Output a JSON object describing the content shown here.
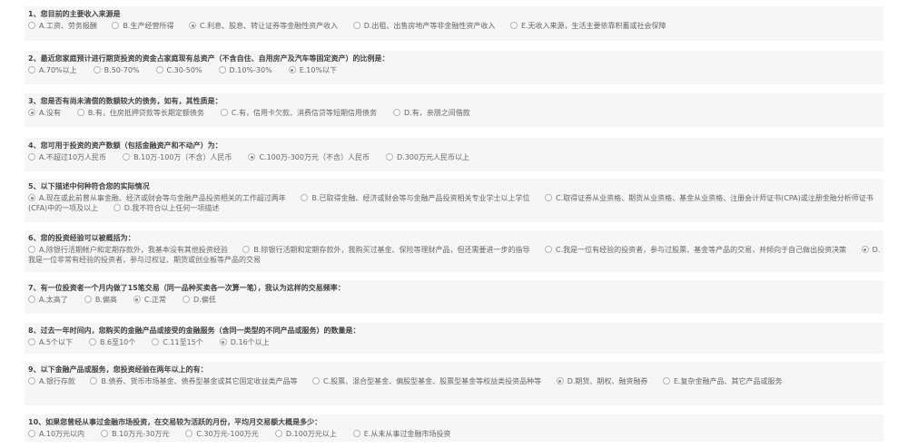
{
  "questions": [
    {
      "title": "1、您目前的主要收入来源是",
      "selected": 2,
      "wrap": true,
      "options": [
        "A.工资、劳务报酬",
        "B.生产经营所得",
        "C.利息、股息、转让证券等金融性资产收入",
        "D.出租、出售房地产等非金融性资产收入",
        "E.无收入来源，生活主要依靠积蓄或社会保障"
      ]
    },
    {
      "title": "2、最近您家庭预计进行期货投资的资金占家庭现有总资产（不含自住、自用房产及汽车等固定资产）的比例是：",
      "selected": 4,
      "wrap": false,
      "options": [
        "A.70%以上",
        "B.50-70%",
        "C.30-50%",
        "D.10%-30%",
        "E.10%以下"
      ]
    },
    {
      "title": "3、您是否有尚未清偿的数额较大的债务，如有，其性质是：",
      "selected": 0,
      "wrap": false,
      "options": [
        "A.没有",
        "B.有，住房抵押贷款等长期定额债务",
        "C.有，信用卡欠款、消费信贷等短期信用债务",
        "D.有，亲朋之间借款"
      ]
    },
    {
      "title": "4、您可用于投资的资产数额（包括金融资产和不动产）为：",
      "selected": 2,
      "wrap": false,
      "options": [
        "A.不超过10万人民币",
        "B.10万-100万（不含）人民币",
        "C.100万-300万元（不含）人民币",
        "D.300万元人民币以上"
      ]
    },
    {
      "title": "5、以下描述中何种符合您的实际情况",
      "selected": 0,
      "wrap": true,
      "options": [
        "A.现在或此前曾从事金融、经济或财会等与金融产品投资相关的工作超过两年",
        "B.已取得金融、经济或财会等与金融产品投资相关专业学士以上学位",
        "C.取得证券从业资格、期货从业资格、基金从业资格、注册会计师证书(CPA)或注册金融分析师证书(CFA)中的一项及以上",
        "D.我不符合以上任何一项描述"
      ]
    },
    {
      "title": "6、您的投资经验可以被概括为：",
      "selected": 3,
      "wrap": true,
      "options": [
        "A.除银行活期帐户和定期存款外，我基本没有其他投资经验",
        "B.除银行活期和定期存款外，我购买过基金、保险等理财产品，但还需要进一步的指导",
        "C.我是一位有经验的投资者，参与过股票、基金等产品的交易，并倾向于自己做出投资决策",
        "D.我是一位非常有经验的投资者，参与过权证、期货或创业板等产品的交易"
      ]
    },
    {
      "title": "7、有一位投资者一个月内做了15笔交易（同一品种买卖各一次算一笔），我认为这样的交易频率：",
      "selected": 2,
      "wrap": false,
      "options": [
        "A.太高了",
        "B.偏高",
        "C.正常",
        "D.偏低"
      ]
    },
    {
      "title": "8、过去一年时间内，您购买的金融产品或接受的金融服务（含同一类型的不同产品或服务）的数量是：",
      "selected": 3,
      "wrap": false,
      "options": [
        "A.5个以下",
        "B.6至10个",
        "C.11至15个",
        "D.16个以上"
      ]
    },
    {
      "title": "9、以下金融产品或服务，您投资经验在两年以上的有：",
      "selected": 3,
      "wrap": true,
      "options": [
        "A.银行存款",
        "B.债券、货币市场基金、债券型基金或其它固定收益类产品等",
        "C.股票、混合型基金、偏股型基金、股票型基金等权益类投资品种等",
        "D.期货、期权、融资融券",
        "E.复杂金融产品、其它产品或服务"
      ]
    },
    {
      "title": "10、如果您曾经从事过金融市场投资，在交易较为活跃的月份，平均月交易额大概是多少：",
      "selected": -1,
      "wrap": false,
      "options": [
        "A.10万元以内",
        "B.10万元-30万元",
        "C.30万元-100万元",
        "D.100万元以上",
        "E.从未从事过金融市场投资"
      ]
    }
  ]
}
